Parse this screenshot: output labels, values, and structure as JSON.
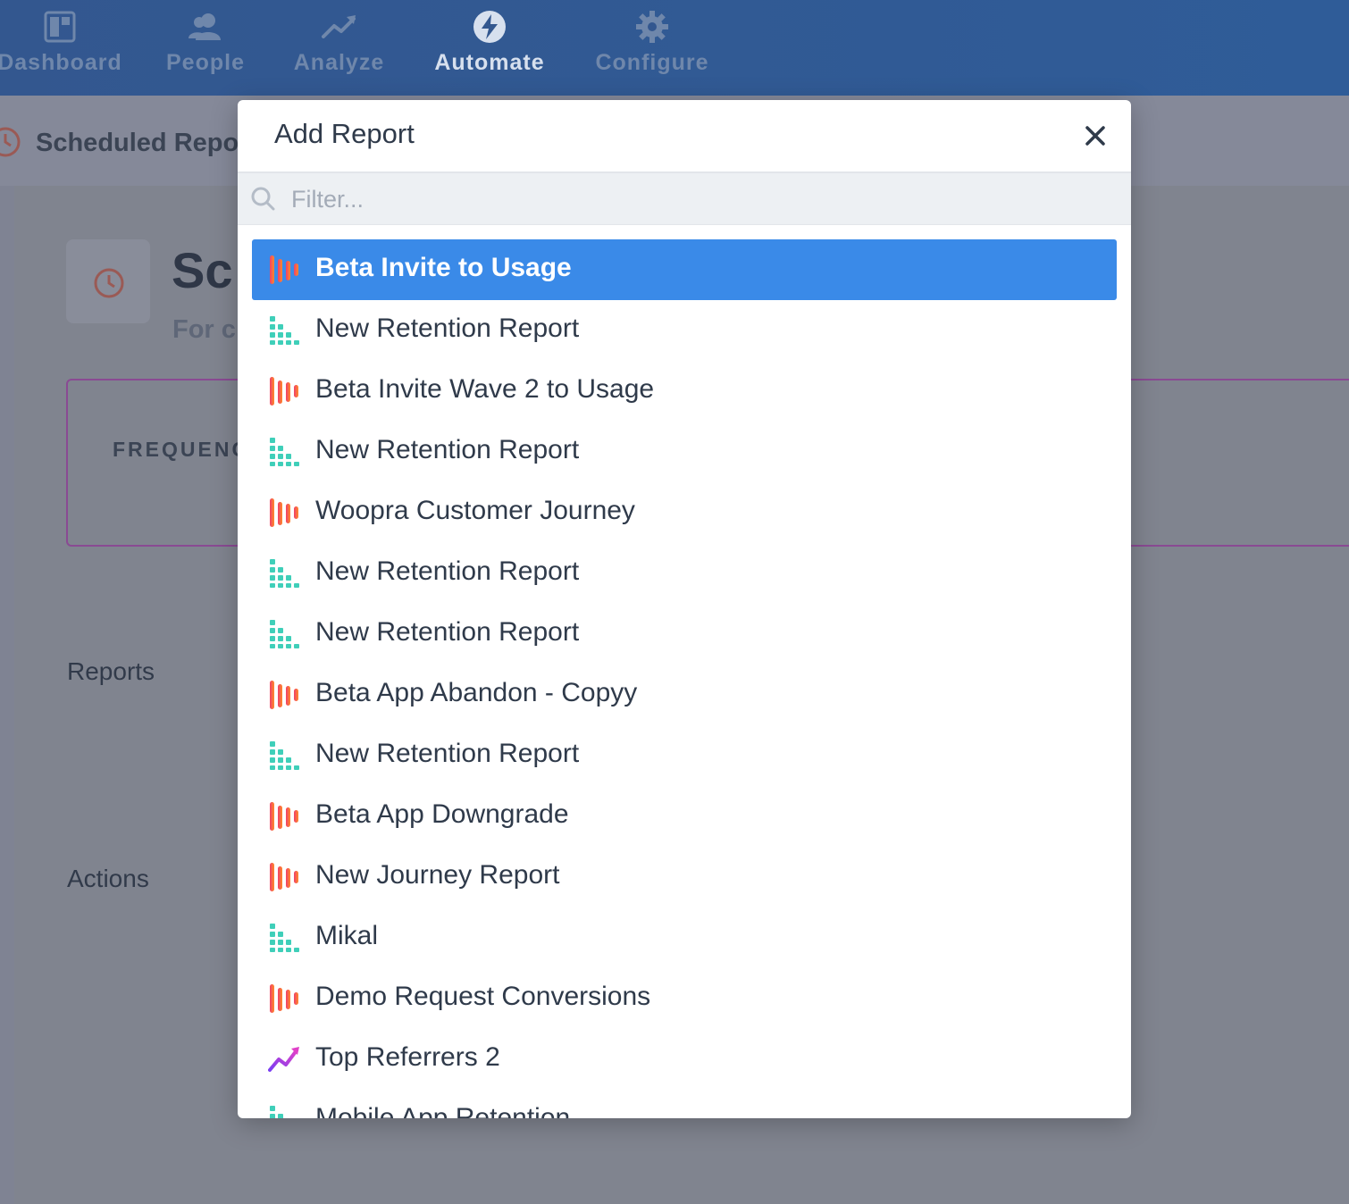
{
  "nav": {
    "items": [
      {
        "label": "Dashboard",
        "icon": "dashboard-icon"
      },
      {
        "label": "People",
        "icon": "people-icon"
      },
      {
        "label": "Analyze",
        "icon": "analyze-icon"
      },
      {
        "label": "Automate",
        "icon": "bolt-icon",
        "active": true
      },
      {
        "label": "Configure",
        "icon": "gear-icon"
      }
    ]
  },
  "page": {
    "header_title": "Scheduled Repo",
    "title": "Sc",
    "subtitle": "For c",
    "frequency_label": "FREQUENC",
    "reports_label": "Reports",
    "actions_label": "Actions"
  },
  "modal": {
    "title": "Add Report",
    "filter_placeholder": "Filter...",
    "reports": [
      {
        "label": "Beta Invite to Usage",
        "type": "journey",
        "selected": true
      },
      {
        "label": "New Retention Report",
        "type": "retention"
      },
      {
        "label": "Beta Invite Wave 2 to Usage",
        "type": "journey"
      },
      {
        "label": "New Retention Report",
        "type": "retention"
      },
      {
        "label": "Woopra Customer Journey",
        "type": "journey"
      },
      {
        "label": "New Retention Report",
        "type": "retention"
      },
      {
        "label": "New Retention Report",
        "type": "retention"
      },
      {
        "label": "Beta App Abandon - Copyy",
        "type": "journey"
      },
      {
        "label": "New Retention Report",
        "type": "retention"
      },
      {
        "label": "Beta App Downgrade",
        "type": "journey"
      },
      {
        "label": "New Journey Report",
        "type": "journey"
      },
      {
        "label": "Mikal",
        "type": "retention"
      },
      {
        "label": "Demo Request Conversions",
        "type": "journey"
      },
      {
        "label": "Top Referrers 2",
        "type": "trend"
      },
      {
        "label": "Mobile App Retention",
        "type": "retention"
      }
    ]
  },
  "colors": {
    "nav_bg": "#33578f",
    "selected_bg": "#3a8ae8",
    "retention_icon": "#3fcfb9",
    "journey_icon_start": "#f0406a",
    "journey_icon_end": "#ff8a2a",
    "trend_icon_start": "#7b3ff2",
    "trend_icon_end": "#e040c8"
  }
}
